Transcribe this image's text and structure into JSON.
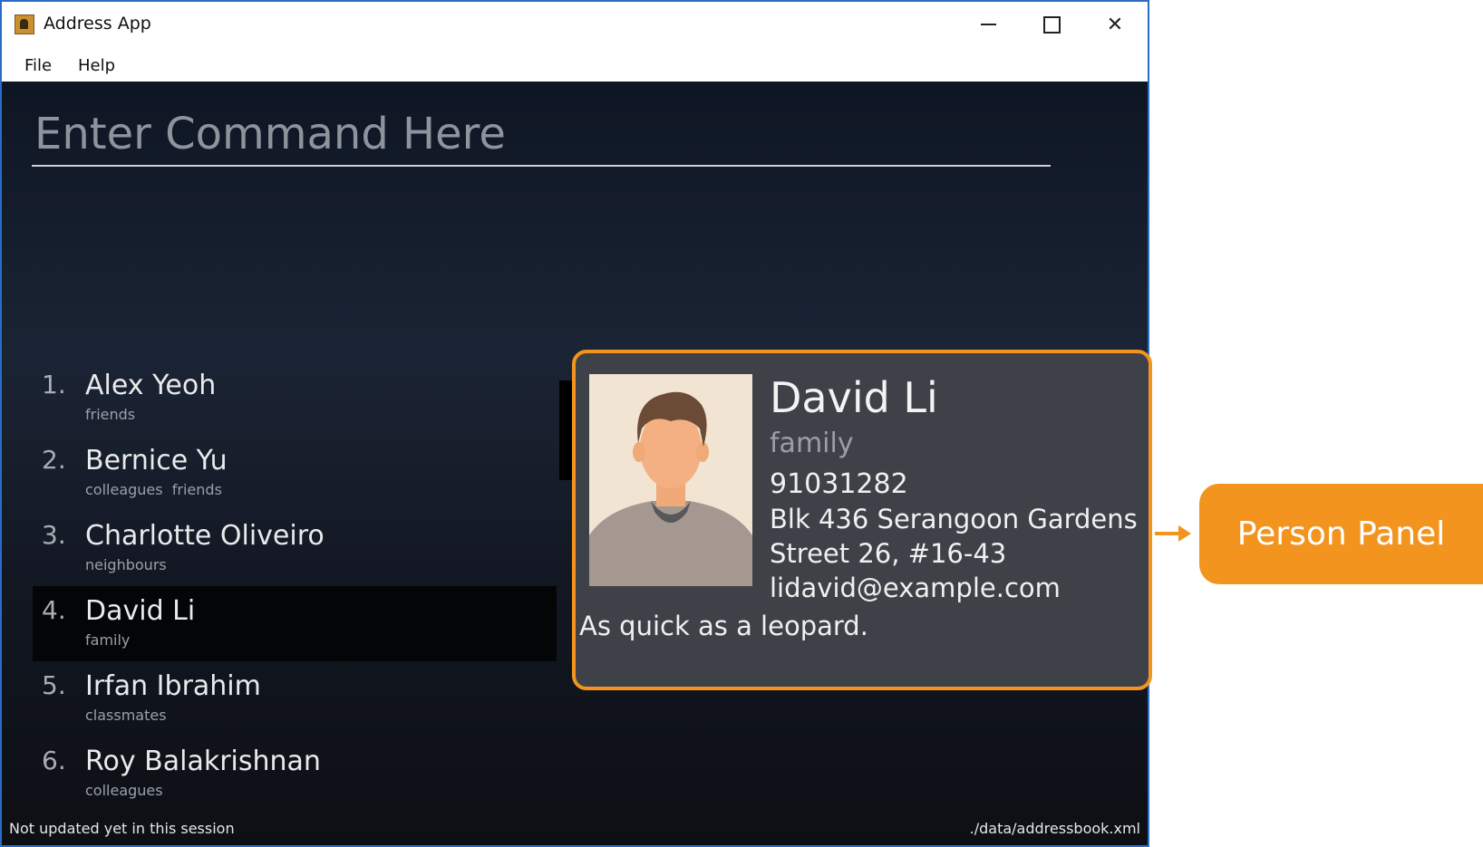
{
  "window": {
    "title": "Address App"
  },
  "menu": {
    "items": [
      "File",
      "Help"
    ]
  },
  "command_box": {
    "placeholder": "Enter Command Here"
  },
  "person_list": [
    {
      "index": "1.",
      "name": "Alex Yeoh",
      "tags": "friends"
    },
    {
      "index": "2.",
      "name": "Bernice Yu",
      "tags": "colleagues  friends"
    },
    {
      "index": "3.",
      "name": "Charlotte Oliveiro",
      "tags": "neighbours"
    },
    {
      "index": "4.",
      "name": "David Li",
      "tags": "family",
      "selected": true
    },
    {
      "index": "5.",
      "name": "Irfan Ibrahim",
      "tags": "classmates"
    },
    {
      "index": "6.",
      "name": "Roy Balakrishnan",
      "tags": "colleagues"
    }
  ],
  "person_panel": {
    "name": "David Li",
    "tag": "family",
    "phone": "91031282",
    "address": "Blk 436 Serangoon Gardens Street 26, #16-43",
    "email": "lidavid@example.com",
    "description": "As quick as a leopard."
  },
  "status_bar": {
    "left": "Not updated yet in this session",
    "right": "./data/addressbook.xml"
  },
  "annotation": {
    "label": "Person Panel",
    "color": "#f3941f"
  },
  "icons": [
    "app-icon",
    "minimize-icon",
    "maximize-icon",
    "close-icon",
    "avatar"
  ]
}
